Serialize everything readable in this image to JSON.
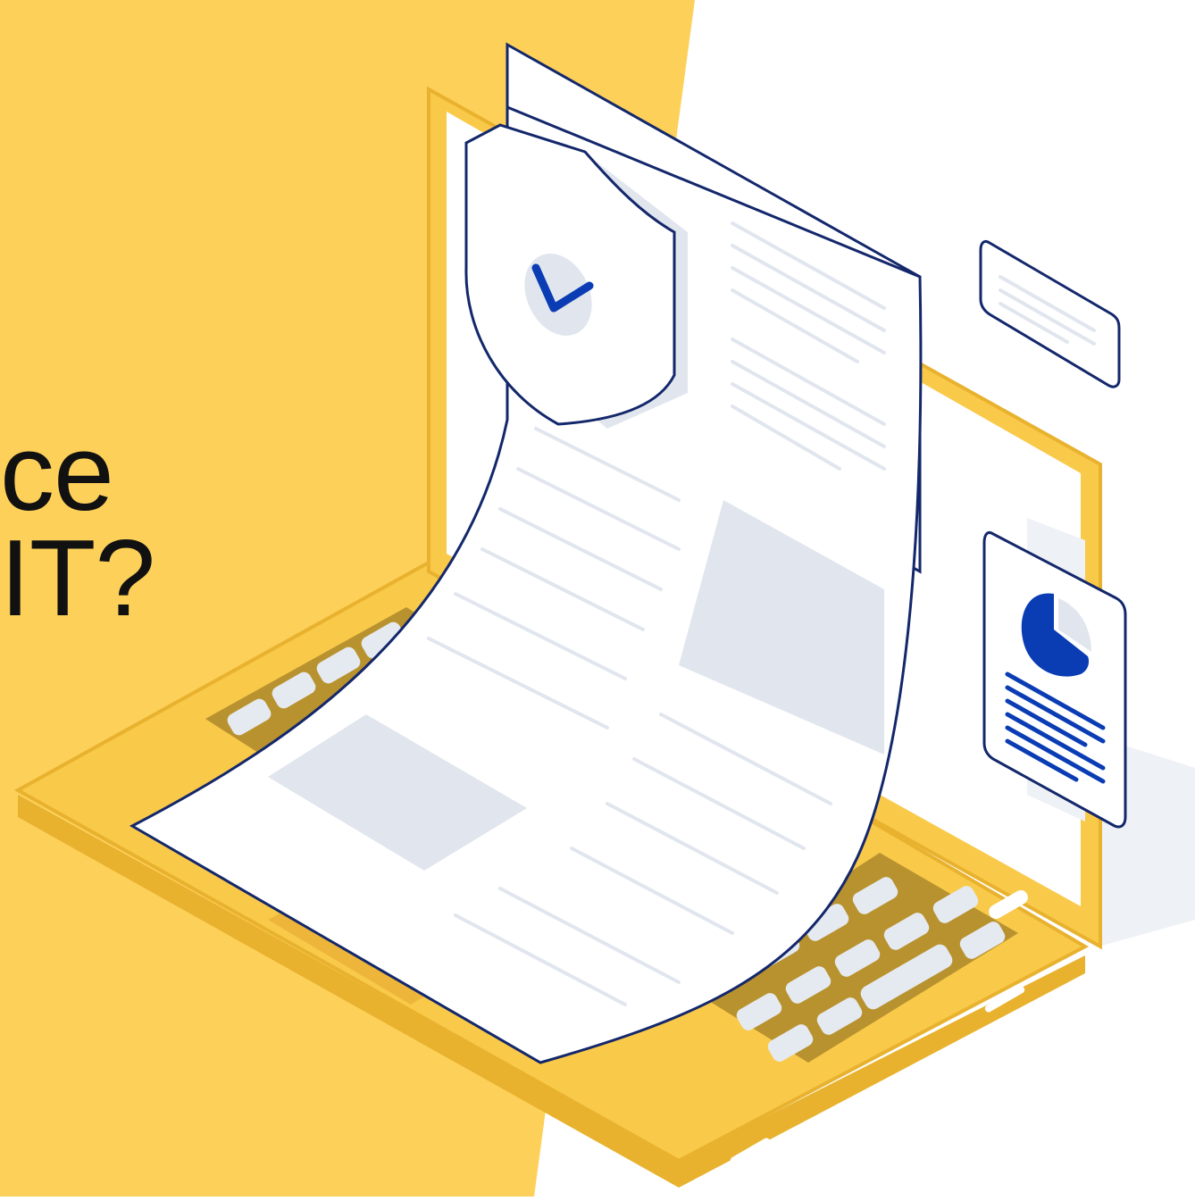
{
  "headline": {
    "line1": "ce",
    "line2": "IT?"
  },
  "colors": {
    "background_panel": "#FDD05A",
    "laptop_body": "#F9C94A",
    "laptop_outline": "#E8B22E",
    "keyboard_recess": "#B8922E",
    "key_fill": "#E5EAF1",
    "paper_fill": "#FFFFFF",
    "outline_navy": "#13276B",
    "accent_blue": "#0A3CB4",
    "placeholder_gray": "#E1E6EE",
    "page_background": "#FFFFFF"
  },
  "icons": [
    "shield-check-icon",
    "pie-chart-icon"
  ]
}
